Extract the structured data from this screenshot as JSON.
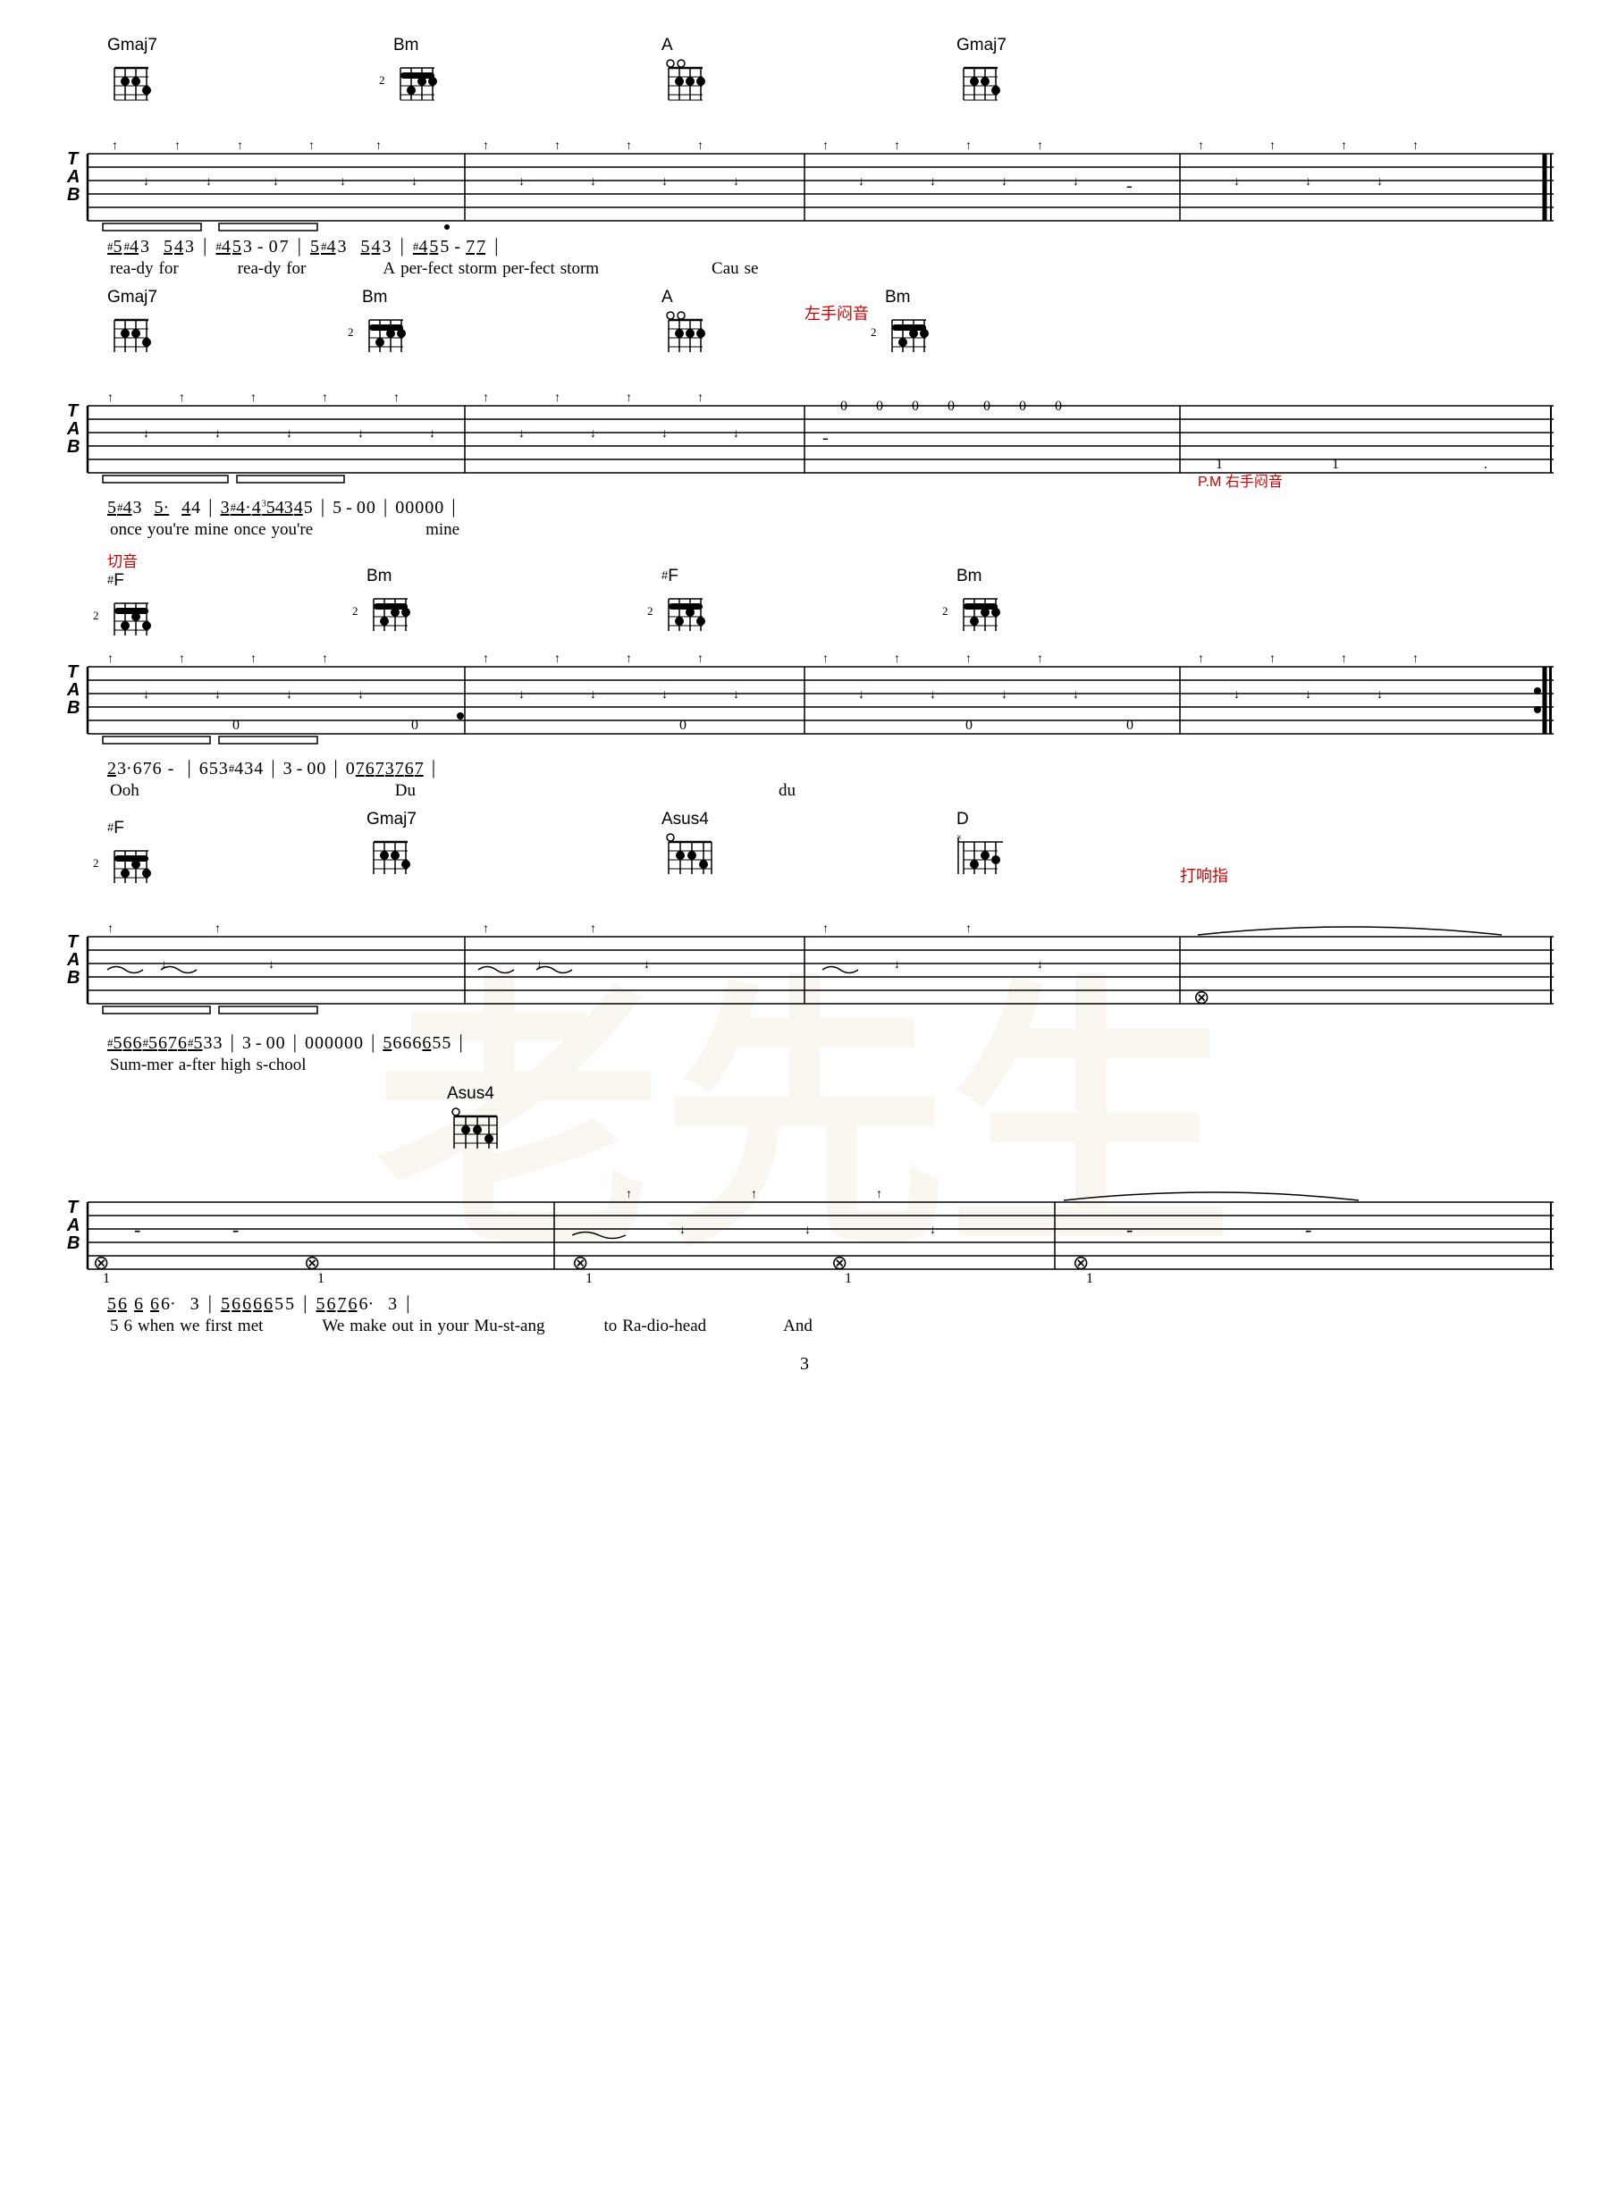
{
  "page": {
    "number": "3",
    "watermark": "老先生"
  },
  "sections": [
    {
      "id": "section1",
      "chords": [
        {
          "name": "Gmaj7",
          "fret": null,
          "position_pct": 5
        },
        {
          "name": "Bm",
          "fret": "2",
          "position_pct": 30
        },
        {
          "name": "A",
          "fret": null,
          "position_pct": 54
        },
        {
          "name": "Gmaj7",
          "fret": null,
          "position_pct": 78
        }
      ],
      "notation": "5 #4 3  5 4 3 | #4 5 3 - 0 7 | 5 #4 3  5 4 3 | #4 5 5 - 7 7",
      "lyrics": "rea-dy for  rea-dy for  A per-fect storm per-fect storm  Cau se"
    },
    {
      "id": "section2",
      "chords": [
        {
          "name": "Gmaj7",
          "fret": null,
          "position_pct": 5
        },
        {
          "name": "Bm",
          "fret": "2",
          "position_pct": 28
        },
        {
          "name": "A",
          "fret": null,
          "position_pct": 52
        },
        {
          "name": "Bm",
          "fret": "2",
          "position_pct": 75
        }
      ],
      "annotations": [
        {
          "text": "左手闷音",
          "color": "red",
          "position_pct": 63
        },
        {
          "text": "P.M 右手闷音",
          "color": "red",
          "position_pct": 80
        }
      ],
      "notation": "5 #4 3  5·  4 4 | 3 #4· 4 543 4 5 | 5 - 0 0 | 0 0 0 0 0",
      "lyrics": "once you're mine once you're  mine"
    },
    {
      "id": "section3",
      "chords": [
        {
          "name": "#F",
          "fret": "2",
          "position_pct": 3,
          "annotation": "切音",
          "annotation_color": "red"
        },
        {
          "name": "Bm",
          "fret": "2",
          "position_pct": 26
        },
        {
          "name": "#F",
          "fret": "2",
          "position_pct": 50
        },
        {
          "name": "Bm",
          "fret": "2",
          "position_pct": 73
        }
      ],
      "notation": "2 3· 6 7 6 -  | 6 5 3 #4 3 4 | 3 - 0 0 | 0 7 6 7 3 7 6 7",
      "lyrics": "Ooh  Du  du"
    },
    {
      "id": "section4",
      "chords": [
        {
          "name": "#F",
          "fret": "2",
          "position_pct": 3
        },
        {
          "name": "Gmaj7",
          "fret": null,
          "position_pct": 25
        },
        {
          "name": "Asus4",
          "fret": null,
          "position_pct": 50
        },
        {
          "name": "D",
          "fret": null,
          "position_pct": 73
        }
      ],
      "annotations": [
        {
          "text": "打响指",
          "color": "red",
          "position_pct": 85
        }
      ],
      "notation": "#5 6 6 #5 6 7 6 #5 3 3 | 3 - 0 0 | 0 0 0 0 0 0 | 5 6 6 6 6 5 5",
      "lyrics": "Sum-mer a-fter high s-chool"
    },
    {
      "id": "section5",
      "chords": [
        {
          "name": "Asus4",
          "fret": null,
          "position_pct": 30
        }
      ],
      "notation": "5 6  6  6 6·  3 | 5 6 6 6 6 5 5 | 5 6 7 6 6·  3",
      "lyrics": "when we first met  We make out in your Mu-st-ang  to Ra-dio-head  And"
    }
  ]
}
